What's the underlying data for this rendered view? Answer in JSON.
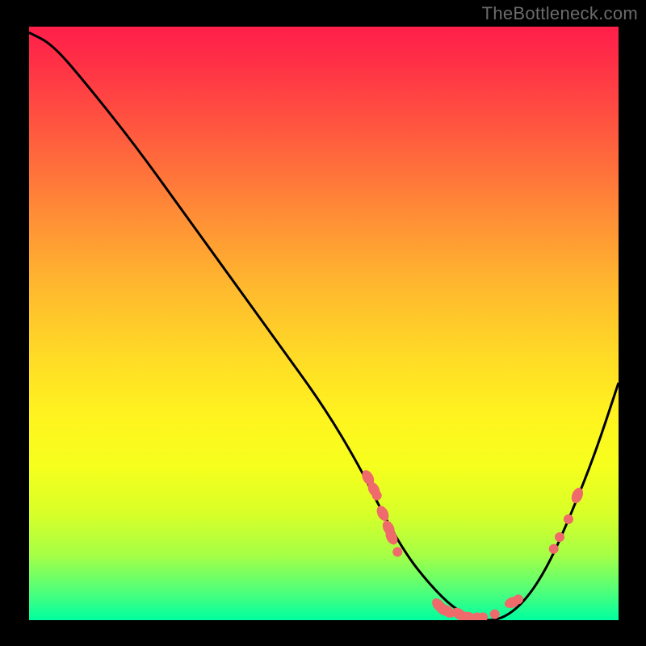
{
  "watermark": "TheBottleneck.com",
  "colors": {
    "frame": "#000000",
    "gradient_top": "#ff1e4a",
    "gradient_bottom": "#00ffa0",
    "curve": "#000000",
    "marker": "#ef6a6a"
  },
  "chart_data": {
    "type": "line",
    "title": "",
    "xlabel": "",
    "ylabel": "",
    "xlim": [
      0,
      100
    ],
    "ylim": [
      0,
      100
    ],
    "grid": false,
    "legend": false,
    "series": [
      {
        "name": "bottleneck-curve",
        "x": [
          0,
          4,
          10,
          18,
          26,
          34,
          42,
          50,
          56,
          60,
          64,
          68,
          72,
          76,
          80,
          84,
          88,
          92,
          96,
          100
        ],
        "y": [
          99,
          97,
          90,
          80,
          69,
          58,
          47,
          36,
          26,
          18,
          11,
          6,
          2,
          0,
          0,
          3,
          9,
          18,
          28,
          40
        ]
      }
    ],
    "markers": [
      {
        "x": 57.5,
        "y": 24.0,
        "shape": "ellipse"
      },
      {
        "x": 58.5,
        "y": 22.0,
        "shape": "ellipse"
      },
      {
        "x": 59.0,
        "y": 21.0,
        "shape": "circle"
      },
      {
        "x": 60.0,
        "y": 18.0,
        "shape": "ellipse"
      },
      {
        "x": 61.0,
        "y": 15.5,
        "shape": "ellipse"
      },
      {
        "x": 61.5,
        "y": 14.0,
        "shape": "ellipse"
      },
      {
        "x": 62.5,
        "y": 11.5,
        "shape": "circle"
      },
      {
        "x": 69.5,
        "y": 2.5,
        "shape": "ellipse"
      },
      {
        "x": 70.0,
        "y": 2.0,
        "shape": "ellipse"
      },
      {
        "x": 71.0,
        "y": 1.5,
        "shape": "ellipse"
      },
      {
        "x": 73.0,
        "y": 1.0,
        "shape": "ellipse"
      },
      {
        "x": 74.5,
        "y": 0.5,
        "shape": "ellipse"
      },
      {
        "x": 76.0,
        "y": 0.5,
        "shape": "circle"
      },
      {
        "x": 77.0,
        "y": 0.5,
        "shape": "circle"
      },
      {
        "x": 79.0,
        "y": 1.0,
        "shape": "circle"
      },
      {
        "x": 82.0,
        "y": 3.0,
        "shape": "ellipse"
      },
      {
        "x": 83.0,
        "y": 3.5,
        "shape": "circle"
      },
      {
        "x": 89.0,
        "y": 12.0,
        "shape": "circle"
      },
      {
        "x": 90.0,
        "y": 14.0,
        "shape": "circle"
      },
      {
        "x": 91.5,
        "y": 17.0,
        "shape": "circle"
      },
      {
        "x": 93.0,
        "y": 21.0,
        "shape": "ellipse"
      }
    ]
  }
}
